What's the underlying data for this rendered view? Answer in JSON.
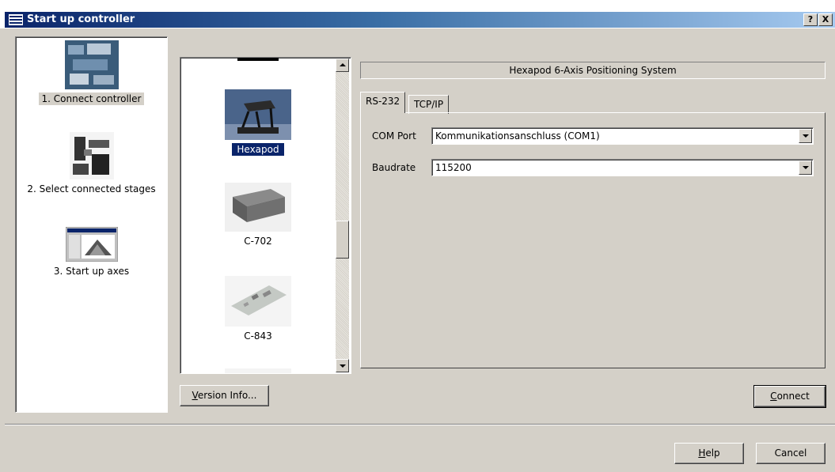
{
  "window": {
    "title": "Start up controller",
    "help_glyph": "?",
    "close_glyph": "X"
  },
  "nav": {
    "steps": [
      {
        "label": "1. Connect controller",
        "active": true
      },
      {
        "label": "2. Select connected stages",
        "active": false
      },
      {
        "label": "3. Start up axes",
        "active": false
      }
    ]
  },
  "controllers": {
    "items": [
      {
        "label": "Hexapod",
        "selected": true,
        "icon": "hexapod-image"
      },
      {
        "label": "C-702",
        "selected": false,
        "icon": "c702-controller-image"
      },
      {
        "label": "C-843",
        "selected": false,
        "icon": "c843-card-image"
      }
    ]
  },
  "system_name": "Hexapod 6-Axis Positioning System",
  "tabs": [
    {
      "label": "RS-232",
      "active": true
    },
    {
      "label": "TCP/IP",
      "active": false
    }
  ],
  "rs232": {
    "com_port_label": "COM Port",
    "com_port_value": "Kommunikationsanschluss (COM1)",
    "baudrate_label": "Baudrate",
    "baudrate_value": "115200"
  },
  "buttons": {
    "version_info_mnemonic": "V",
    "version_info_rest": "ersion Info...",
    "connect_mnemonic": "C",
    "connect_rest": "onnect",
    "help_mnemonic": "H",
    "help_rest": "elp",
    "cancel": "Cancel"
  },
  "colors": {
    "dialog_bg": "#d4d0c8",
    "title_active": "#0a246a",
    "selection": "#0a246a"
  }
}
